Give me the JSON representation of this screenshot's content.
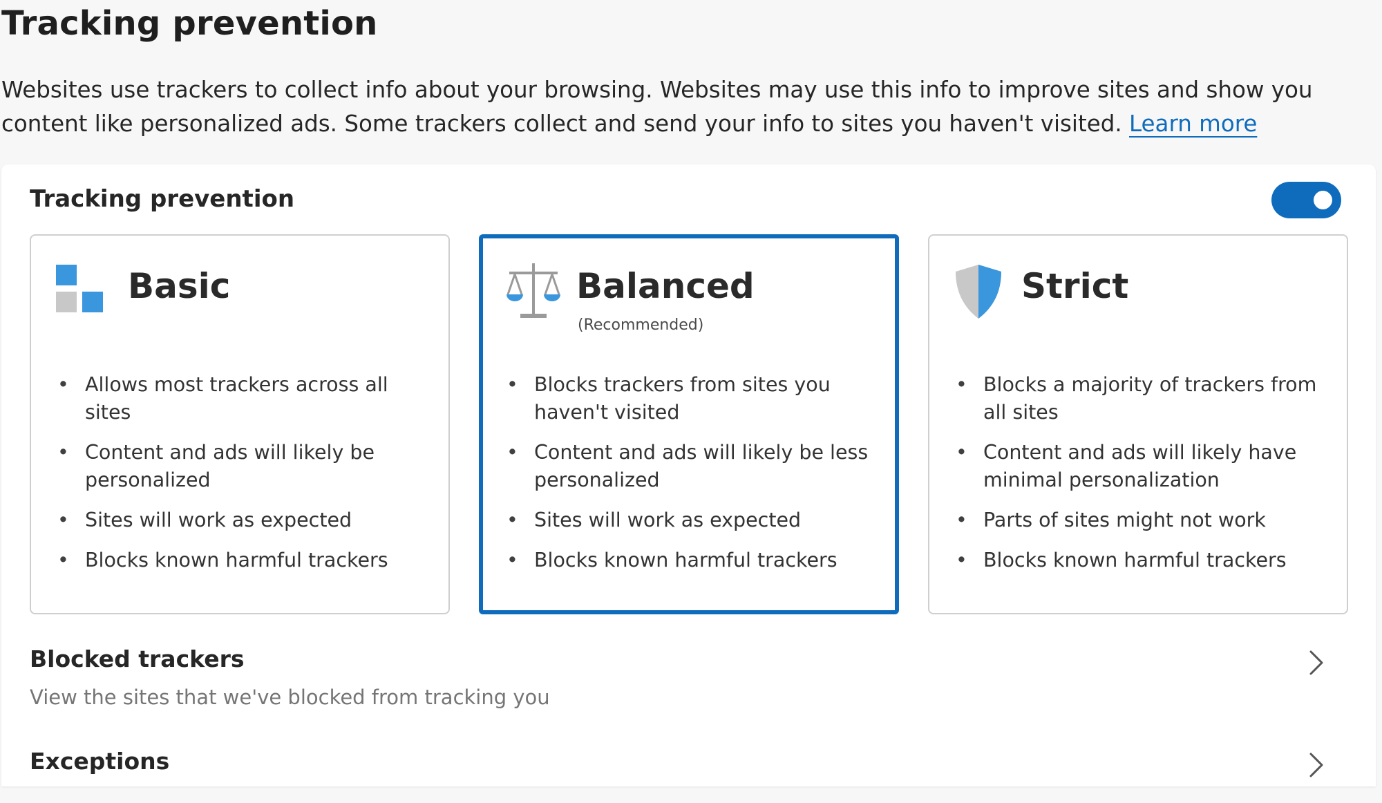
{
  "page": {
    "title": "Tracking prevention",
    "description": "Websites use trackers to collect info about your browsing. Websites may use this info to improve sites and show you content like personalized ads. Some trackers collect and send your info to sites you haven't visited.",
    "learn_more": "Learn more"
  },
  "settings": {
    "section_label": "Tracking prevention",
    "toggle_on": true
  },
  "levels": [
    {
      "title": "Basic",
      "subtitle": "",
      "icon": "basic-squares-icon",
      "selected": false,
      "features": [
        "Allows most trackers across all sites",
        "Content and ads will likely be personalized",
        "Sites will work as expected",
        "Blocks known harmful trackers"
      ]
    },
    {
      "title": "Balanced",
      "subtitle": "(Recommended)",
      "icon": "balance-scale-icon",
      "selected": true,
      "features": [
        "Blocks trackers from sites you haven't visited",
        "Content and ads will likely be less personalized",
        "Sites will work as expected",
        "Blocks known harmful trackers"
      ]
    },
    {
      "title": "Strict",
      "subtitle": "",
      "icon": "shield-icon",
      "selected": false,
      "features": [
        "Blocks a majority of trackers from all sites",
        "Content and ads will likely have minimal personalization",
        "Parts of sites might not work",
        "Blocks known harmful trackers"
      ]
    }
  ],
  "rows": {
    "blocked_trackers": {
      "title": "Blocked trackers",
      "description": "View the sites that we've blocked from tracking you"
    },
    "exceptions": {
      "title": "Exceptions"
    }
  },
  "colors": {
    "accent": "#0f6cbd",
    "icon_blue": "#3a96dd",
    "icon_gray": "#c8c8c8"
  }
}
